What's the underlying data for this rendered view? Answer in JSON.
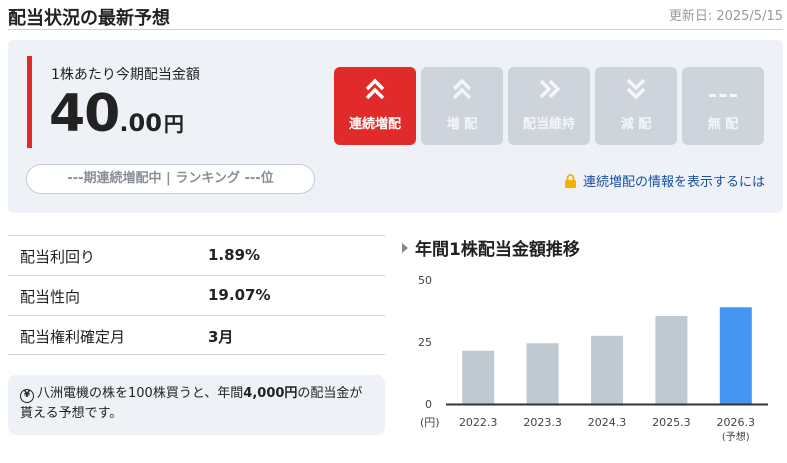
{
  "header": {
    "title": "配当状況の最新予想",
    "updated": "更新日: 2025/5/15"
  },
  "dividend": {
    "label": "1株あたり今期配当金額",
    "value_int": "40",
    "value_dec": ".00",
    "unit": "円",
    "ranking": "---期連続増配中 | ランキング ---位",
    "lock_link": "連続増配の情報を表示するには"
  },
  "status_buttons": [
    {
      "label": "連続増配",
      "icon": "double-chevron-up-icon",
      "glyph": "︽",
      "active": true
    },
    {
      "label": "増 配",
      "icon": "chevron-up-icon",
      "glyph": "︽",
      "active": false
    },
    {
      "label": "配当維持",
      "icon": "double-chevron-right-icon",
      "glyph": "»",
      "active": false
    },
    {
      "label": "減 配",
      "icon": "double-chevron-down-icon",
      "glyph": "︾",
      "active": false
    },
    {
      "label": "無 配",
      "icon": "dashes-icon",
      "glyph": "---",
      "active": false
    }
  ],
  "stats": [
    {
      "label": "配当利回り",
      "value": "1.89%"
    },
    {
      "label": "配当性向",
      "value": "19.07%"
    },
    {
      "label": "配当権利確定月",
      "value": "3月"
    }
  ],
  "note": {
    "pre": "八洲電機の株を100株買うと、年間",
    "amount": "4,000円",
    "post": "の配当金が貰える予想です。"
  },
  "chart_title": "年間1株配当金額推移",
  "colors": {
    "accent_red": "#e12b2b",
    "bar_gray": "#bfc9d2",
    "bar_blue": "#4596f0",
    "link_blue": "#1a4fa0"
  },
  "chart_data": {
    "type": "bar",
    "categories": [
      "2022.3",
      "2023.3",
      "2024.3",
      "2025.3",
      "2026.3"
    ],
    "category_notes": [
      "",
      "",
      "",
      "",
      "(予想)"
    ],
    "values": [
      21.5,
      24.5,
      27.5,
      35.5,
      39
    ],
    "highlight_index": 4,
    "yticks": [
      0,
      25,
      50
    ],
    "ylim": [
      0,
      50
    ],
    "yunit": "(円)",
    "grid": false
  }
}
